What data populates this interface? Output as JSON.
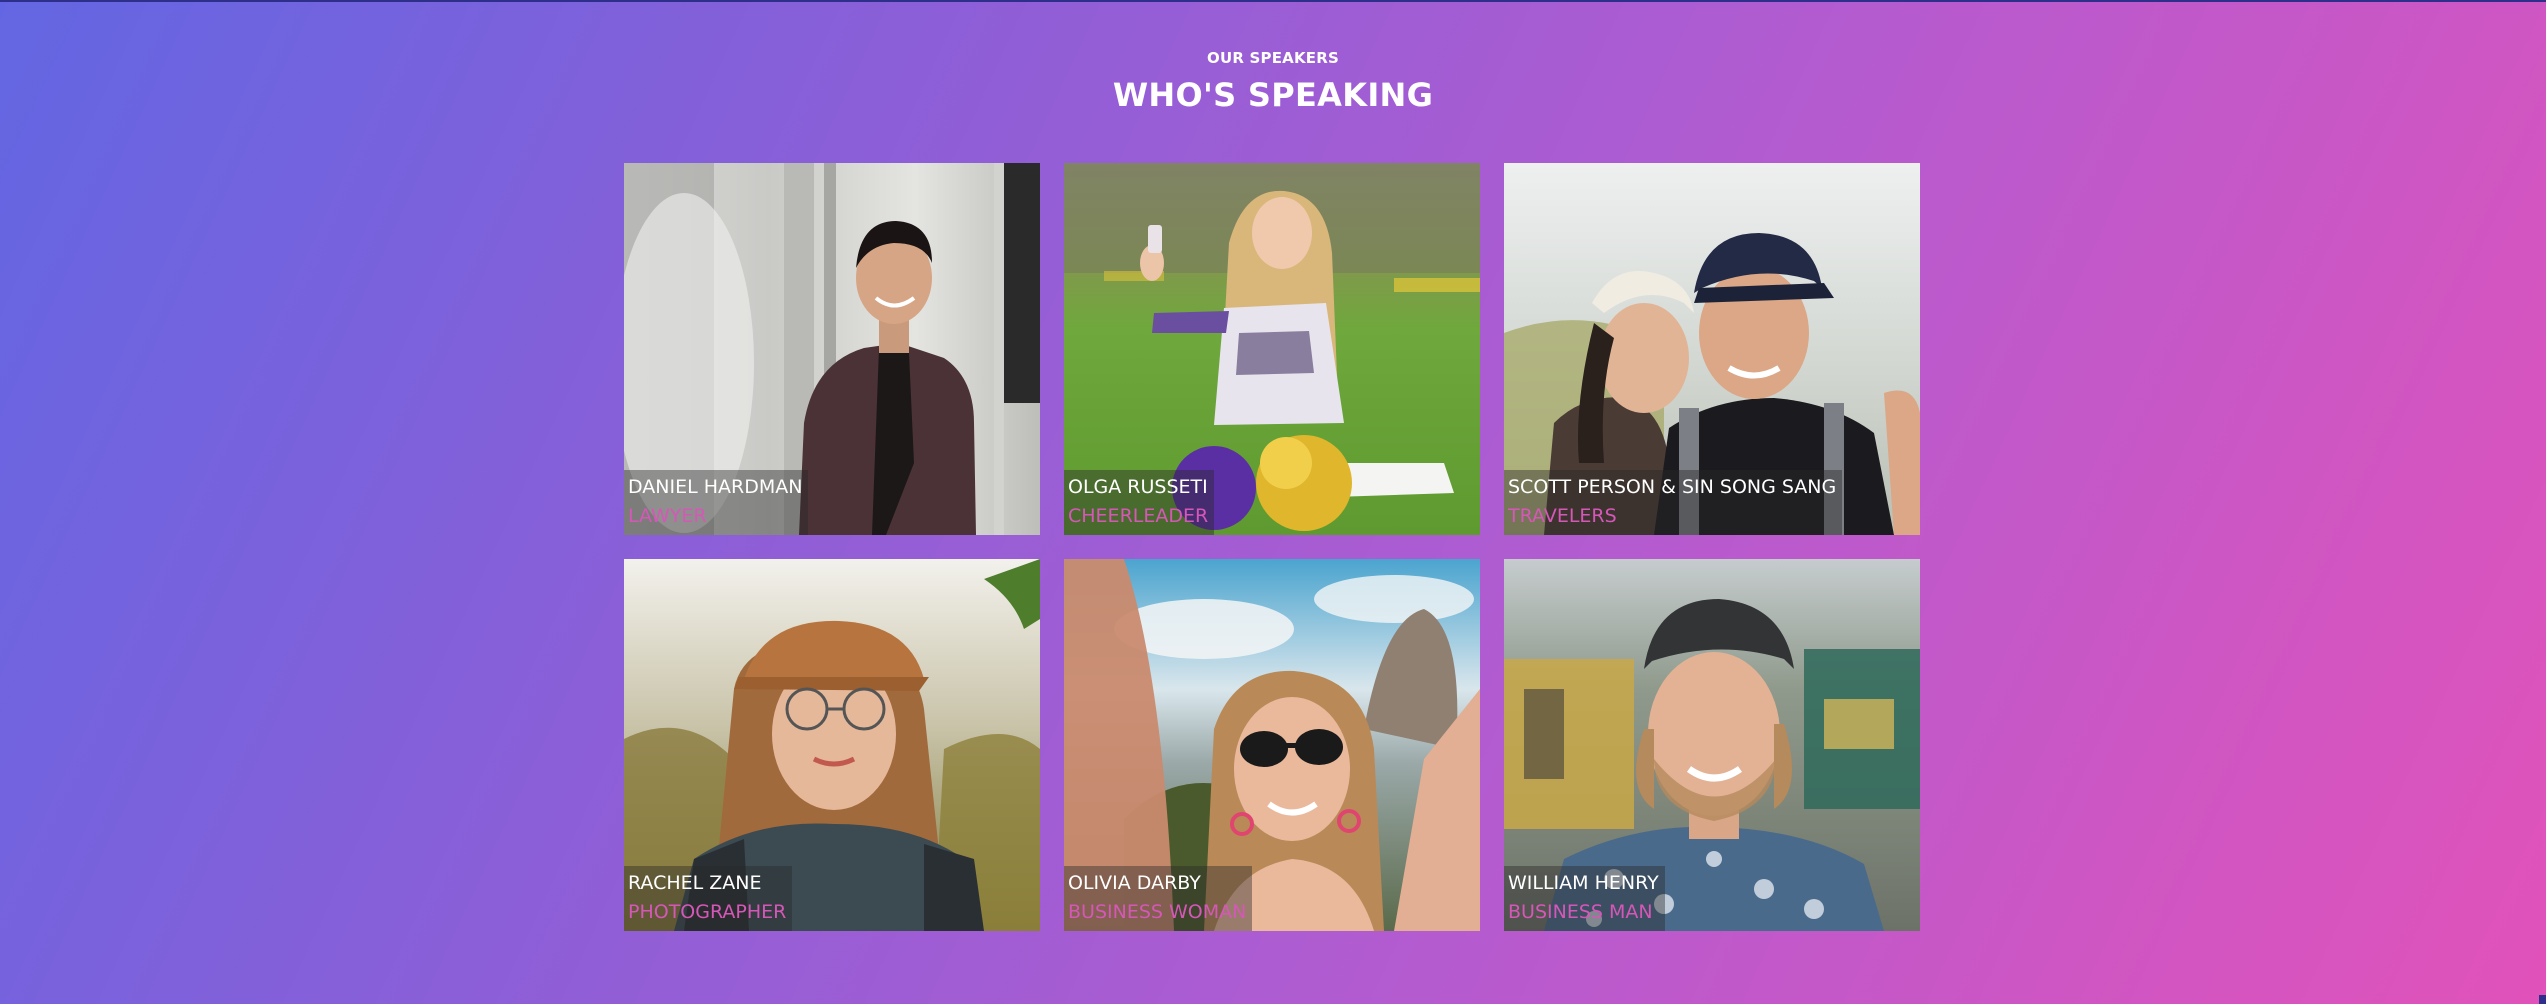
{
  "section": {
    "eyebrow": "OUR SPEAKERS",
    "title": "WHO'S SPEAKING"
  },
  "speakers": [
    {
      "name": "DANIEL HARDMAN",
      "role": "LAWYER"
    },
    {
      "name": "OLGA RUSSETI",
      "role": "CHEERLEADER"
    },
    {
      "name": "SCOTT PERSON & SIN SONG SANG",
      "role": "TRAVELERS"
    },
    {
      "name": "RACHEL ZANE",
      "role": "PHOTOGRAPHER"
    },
    {
      "name": "OLIVIA DARBY",
      "role": "BUSINESS WOMAN"
    },
    {
      "name": "WILLIAM HENRY",
      "role": "BUSINESS MAN"
    }
  ],
  "colors": {
    "gradient_start": "#6366e2",
    "gradient_end": "#e152ba",
    "role_text": "#d657b8",
    "name_text": "#ffffff"
  }
}
